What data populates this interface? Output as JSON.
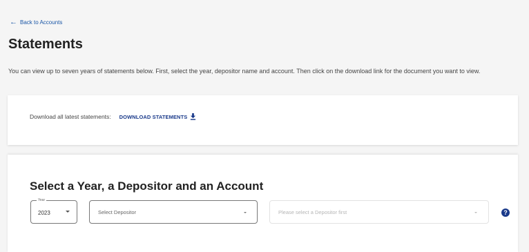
{
  "header": {
    "back_label": "Back to Accounts",
    "title": "Statements"
  },
  "intro": {
    "text": "You can view up to seven years of statements below. First, select the year, depositor name and account. Then click on the download link for the document you want to view."
  },
  "download": {
    "label": "Download all latest statements:",
    "link_label": "DOWNLOAD STATEMENTS"
  },
  "select_section": {
    "title": "Select a Year, a Depositor and an Account",
    "year": {
      "legend": "Year",
      "value": "2023"
    },
    "depositor": {
      "placeholder": "Select Depositor"
    },
    "account": {
      "placeholder": "Please select a Depositor first"
    },
    "help_glyph": "?"
  },
  "colors": {
    "link": "#1a56a6",
    "accent": "#1a3a8a",
    "background": "#f5f5f5",
    "card": "#ffffff"
  },
  "icons": [
    "arrow-left-icon",
    "download-icon",
    "chevron-down-icon",
    "help-icon"
  ]
}
